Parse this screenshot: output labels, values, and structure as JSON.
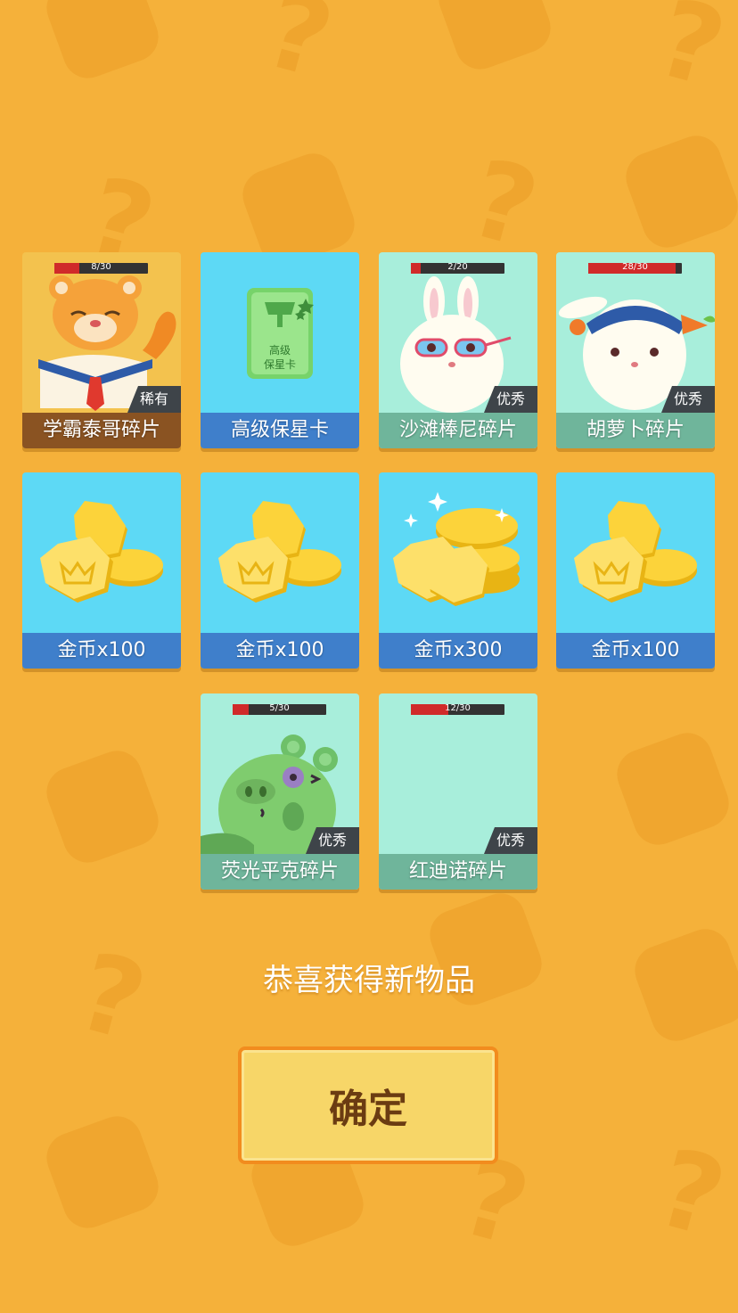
{
  "cards": [
    {
      "label": "学霸泰哥碎片",
      "badge": "稀有",
      "progress": "8/30",
      "progress_fraction": 0.267,
      "theme": "tiger",
      "icon": "tiger-icon"
    },
    {
      "label": "高级保星卡",
      "badge": "",
      "progress": "",
      "theme": "blue",
      "icon": "star-guard-card-icon",
      "card_text": "高级\n保星卡"
    },
    {
      "label": "沙滩棒尼碎片",
      "badge": "优秀",
      "progress": "2/20",
      "progress_fraction": 0.1,
      "theme": "mint",
      "icon": "bunny-goggles-icon"
    },
    {
      "label": "胡萝卜碎片",
      "badge": "优秀",
      "progress": "28/30",
      "progress_fraction": 0.933,
      "theme": "mint",
      "icon": "bunny-carrot-icon"
    },
    {
      "label": "金币x100",
      "theme": "blue",
      "icon": "coins-icon"
    },
    {
      "label": "金币x100",
      "theme": "blue",
      "icon": "coins-icon"
    },
    {
      "label": "金币x300",
      "theme": "blue",
      "icon": "coins-sparkle-icon"
    },
    {
      "label": "金币x100",
      "theme": "blue",
      "icon": "coins-icon"
    },
    {
      "label": "荧光平克碎片",
      "badge": "优秀",
      "progress": "5/30",
      "progress_fraction": 0.167,
      "theme": "mint",
      "icon": "pig-icon"
    },
    {
      "label": "红迪诺碎片",
      "badge": "优秀",
      "progress": "12/30",
      "progress_fraction": 0.4,
      "theme": "mint",
      "icon": ""
    }
  ],
  "message": "恭喜获得新物品",
  "confirm_label": "确定",
  "colors": {
    "background": "#F5B13A",
    "button": "#F7D668",
    "button_border": "#F28C1E"
  }
}
